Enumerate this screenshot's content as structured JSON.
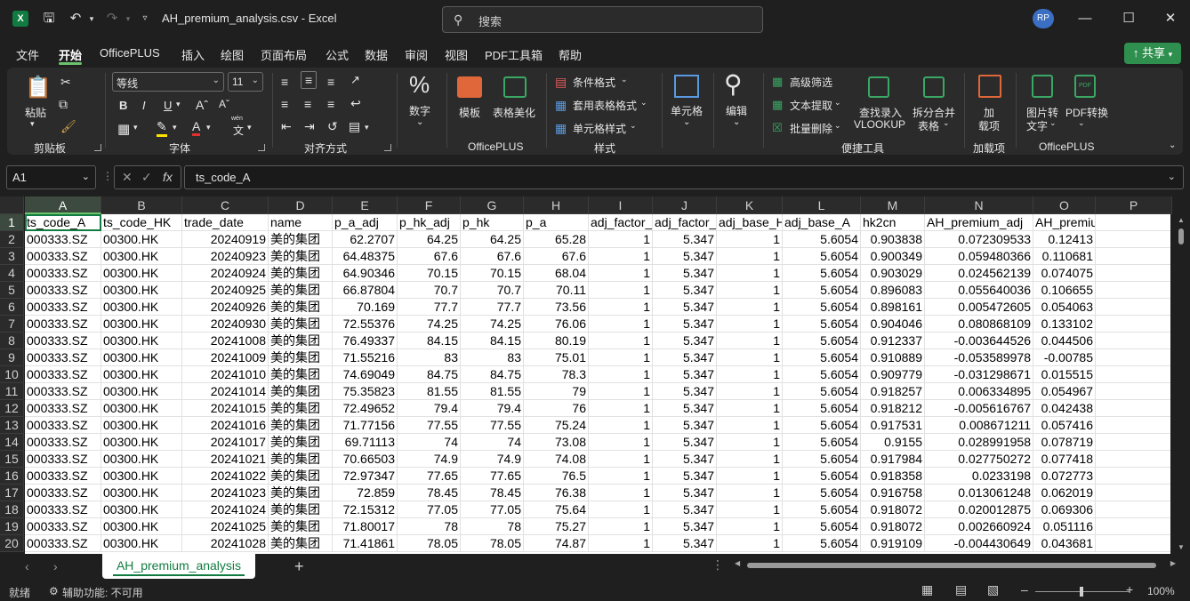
{
  "titlebar": {
    "app_icon": "X",
    "file_title": "AH_premium_analysis.csv  -  Excel",
    "search_placeholder": "搜索",
    "user_initials": "RP",
    "icons": [
      "save-icon",
      "undo-icon",
      "redo-icon",
      "customize-qat-icon",
      "minimize-icon",
      "maximize-icon",
      "close-icon"
    ]
  },
  "menu": {
    "items": [
      "文件",
      "开始",
      "OfficePLUS",
      "插入",
      "绘图",
      "页面布局",
      "公式",
      "数据",
      "审阅",
      "视图",
      "PDF工具箱",
      "帮助"
    ],
    "active": "开始",
    "share_label": "共享"
  },
  "ribbon": {
    "clipboard": {
      "paste": "粘贴",
      "label": "剪贴板"
    },
    "font": {
      "font_name": "等线",
      "font_size": "11",
      "bold": "B",
      "italic": "I",
      "underline": "U",
      "wen": "wén",
      "wen_char": "文",
      "label": "字体"
    },
    "alignment": {
      "label": "对齐方式"
    },
    "number": {
      "button": "数字",
      "percent": "%"
    },
    "officeplus1": {
      "template": "模板",
      "table_beautify": "表格美化",
      "label": "OfficePLUS"
    },
    "styles": {
      "conditional": "条件格式",
      "table_format": "套用表格格式",
      "cell_style": "单元格样式",
      "label": "样式"
    },
    "cells": {
      "button": "单元格"
    },
    "editing": {
      "button": "编辑"
    },
    "convenience": {
      "advanced_filter": "高级筛选",
      "text_extract": "文本提取",
      "batch_delete": "批量删除",
      "vlookup_line1": "查找录入",
      "vlookup_line2": "VLOOKUP",
      "split_line1": "拆分合并",
      "split_line2": "表格",
      "label": "便捷工具"
    },
    "addins": {
      "line1": "加",
      "line2": "载项",
      "label": "加载项"
    },
    "officeplus2": {
      "img2text_line1": "图片转",
      "img2text_line2": "文字",
      "pdf_line1": "PDF转换",
      "pdf_line2": "",
      "label": "OfficePLUS"
    },
    "accent_green": "#107c41"
  },
  "formula_bar": {
    "name_box": "A1",
    "fx": "fx",
    "value": "ts_code_A"
  },
  "sheet": {
    "columns": [
      "A",
      "B",
      "C",
      "D",
      "E",
      "F",
      "G",
      "H",
      "I",
      "J",
      "K",
      "L",
      "M",
      "N",
      "O",
      "P"
    ],
    "rows": [
      [
        "ts_code_A",
        "ts_code_HK",
        "trade_date",
        "name",
        "p_a_adj",
        "p_hk_adj",
        "p_hk",
        "p_a",
        "adj_factor_",
        "adj_factor_",
        "adj_base_H",
        "adj_base_A",
        "hk2cn",
        "AH_premium_adj",
        "AH_premium",
        ""
      ],
      [
        "000333.SZ",
        "00300.HK",
        "20240919",
        "美的集团",
        "62.2707",
        "64.25",
        "64.25",
        "65.28",
        "1",
        "5.347",
        "1",
        "5.6054",
        "0.903838",
        "0.072309533",
        "0.12413",
        ""
      ],
      [
        "000333.SZ",
        "00300.HK",
        "20240923",
        "美的集团",
        "64.48375",
        "67.6",
        "67.6",
        "67.6",
        "1",
        "5.347",
        "1",
        "5.6054",
        "0.900349",
        "0.059480366",
        "0.110681",
        ""
      ],
      [
        "000333.SZ",
        "00300.HK",
        "20240924",
        "美的集团",
        "64.90346",
        "70.15",
        "70.15",
        "68.04",
        "1",
        "5.347",
        "1",
        "5.6054",
        "0.903029",
        "0.024562139",
        "0.074075",
        ""
      ],
      [
        "000333.SZ",
        "00300.HK",
        "20240925",
        "美的集团",
        "66.87804",
        "70.7",
        "70.7",
        "70.11",
        "1",
        "5.347",
        "1",
        "5.6054",
        "0.896083",
        "0.055640036",
        "0.106655",
        ""
      ],
      [
        "000333.SZ",
        "00300.HK",
        "20240926",
        "美的集团",
        "70.169",
        "77.7",
        "77.7",
        "73.56",
        "1",
        "5.347",
        "1",
        "5.6054",
        "0.898161",
        "0.005472605",
        "0.054063",
        ""
      ],
      [
        "000333.SZ",
        "00300.HK",
        "20240930",
        "美的集团",
        "72.55376",
        "74.25",
        "74.25",
        "76.06",
        "1",
        "5.347",
        "1",
        "5.6054",
        "0.904046",
        "0.080868109",
        "0.133102",
        ""
      ],
      [
        "000333.SZ",
        "00300.HK",
        "20241008",
        "美的集团",
        "76.49337",
        "84.15",
        "84.15",
        "80.19",
        "1",
        "5.347",
        "1",
        "5.6054",
        "0.912337",
        "-0.003644526",
        "0.044506",
        ""
      ],
      [
        "000333.SZ",
        "00300.HK",
        "20241009",
        "美的集团",
        "71.55216",
        "83",
        "83",
        "75.01",
        "1",
        "5.347",
        "1",
        "5.6054",
        "0.910889",
        "-0.053589978",
        "-0.00785",
        ""
      ],
      [
        "000333.SZ",
        "00300.HK",
        "20241010",
        "美的集团",
        "74.69049",
        "84.75",
        "84.75",
        "78.3",
        "1",
        "5.347",
        "1",
        "5.6054",
        "0.909779",
        "-0.031298671",
        "0.015515",
        ""
      ],
      [
        "000333.SZ",
        "00300.HK",
        "20241014",
        "美的集团",
        "75.35823",
        "81.55",
        "81.55",
        "79",
        "1",
        "5.347",
        "1",
        "5.6054",
        "0.918257",
        "0.006334895",
        "0.054967",
        ""
      ],
      [
        "000333.SZ",
        "00300.HK",
        "20241015",
        "美的集团",
        "72.49652",
        "79.4",
        "79.4",
        "76",
        "1",
        "5.347",
        "1",
        "5.6054",
        "0.918212",
        "-0.005616767",
        "0.042438",
        ""
      ],
      [
        "000333.SZ",
        "00300.HK",
        "20241016",
        "美的集团",
        "71.77156",
        "77.55",
        "77.55",
        "75.24",
        "1",
        "5.347",
        "1",
        "5.6054",
        "0.917531",
        "0.008671211",
        "0.057416",
        ""
      ],
      [
        "000333.SZ",
        "00300.HK",
        "20241017",
        "美的集团",
        "69.71113",
        "74",
        "74",
        "73.08",
        "1",
        "5.347",
        "1",
        "5.6054",
        "0.9155",
        "0.028991958",
        "0.078719",
        ""
      ],
      [
        "000333.SZ",
        "00300.HK",
        "20241021",
        "美的集团",
        "70.66503",
        "74.9",
        "74.9",
        "74.08",
        "1",
        "5.347",
        "1",
        "5.6054",
        "0.917984",
        "0.027750272",
        "0.077418",
        ""
      ],
      [
        "000333.SZ",
        "00300.HK",
        "20241022",
        "美的集团",
        "72.97347",
        "77.65",
        "77.65",
        "76.5",
        "1",
        "5.347",
        "1",
        "5.6054",
        "0.918358",
        "0.0233198",
        "0.072773",
        ""
      ],
      [
        "000333.SZ",
        "00300.HK",
        "20241023",
        "美的集团",
        "72.859",
        "78.45",
        "78.45",
        "76.38",
        "1",
        "5.347",
        "1",
        "5.6054",
        "0.916758",
        "0.013061248",
        "0.062019",
        ""
      ],
      [
        "000333.SZ",
        "00300.HK",
        "20241024",
        "美的集团",
        "72.15312",
        "77.05",
        "77.05",
        "75.64",
        "1",
        "5.347",
        "1",
        "5.6054",
        "0.918072",
        "0.020012875",
        "0.069306",
        ""
      ],
      [
        "000333.SZ",
        "00300.HK",
        "20241025",
        "美的集团",
        "71.80017",
        "78",
        "78",
        "75.27",
        "1",
        "5.347",
        "1",
        "5.6054",
        "0.918072",
        "0.002660924",
        "0.051116",
        ""
      ],
      [
        "000333.SZ",
        "00300.HK",
        "20241028",
        "美的集团",
        "71.41861",
        "78.05",
        "78.05",
        "74.87",
        "1",
        "5.347",
        "1",
        "5.6054",
        "0.919109",
        "-0.004430649",
        "0.043681",
        ""
      ]
    ],
    "tab_name": "AH_premium_analysis"
  },
  "status": {
    "ready": "就绪",
    "accessibility": "辅助功能: 不可用",
    "zoom": "100%"
  }
}
